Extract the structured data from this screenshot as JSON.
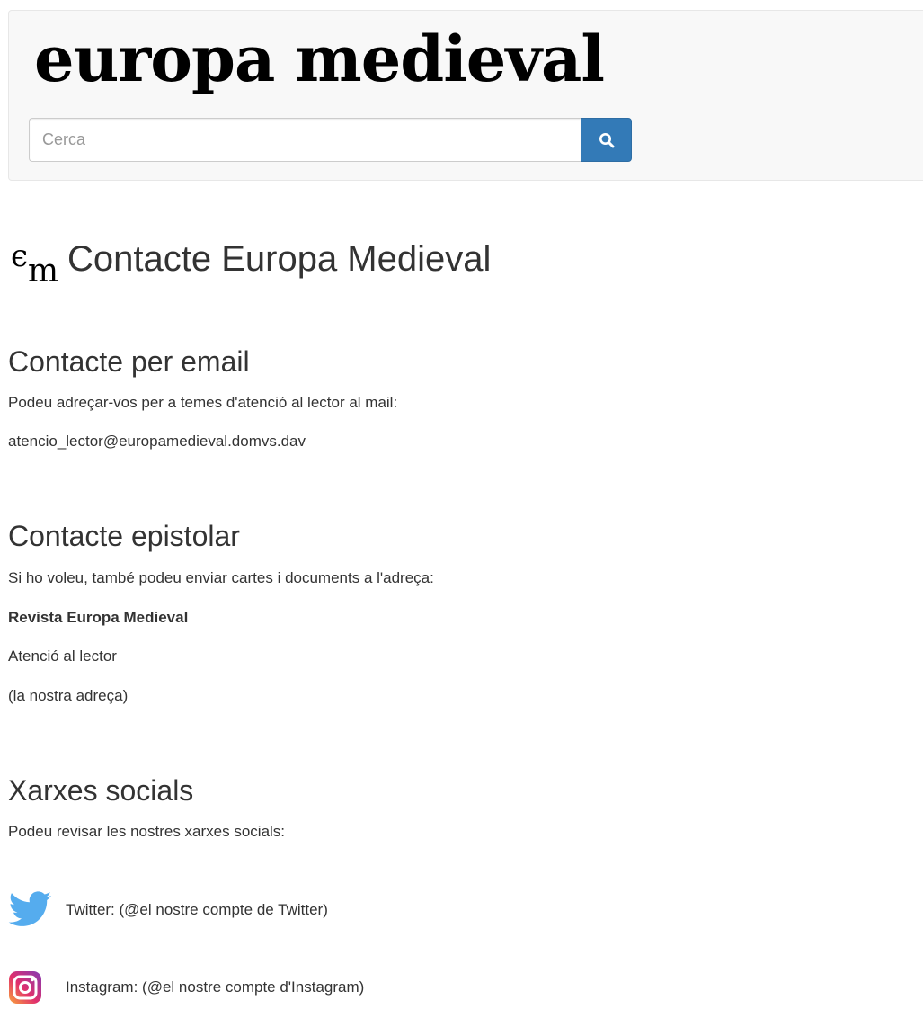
{
  "header": {
    "logo": "europa medieval",
    "search": {
      "placeholder": "Cerca",
      "value": "",
      "button_icon": "search-icon"
    }
  },
  "page": {
    "title_mark": {
      "letter1": "є",
      "letter2": "m"
    },
    "title": "Contacte Europa Medieval"
  },
  "sections": {
    "email": {
      "heading": "Contacte per email",
      "text": "Podeu adreçar-vos per a temes d'atenció al lector al mail:",
      "address": "atencio_lector@europamedieval.domvs.dav"
    },
    "letter": {
      "heading": "Contacte epistolar",
      "text": "Si ho voleu, també podeu enviar cartes i documents a l'adreça:",
      "lines": [
        "Revista Europa Medieval",
        "Atenció al lector",
        "(la nostra adreça)"
      ]
    },
    "social": {
      "heading": "Xarxes socials",
      "text": "Podeu revisar les nostres xarxes socials:",
      "items": [
        {
          "icon": "twitter-icon",
          "label": "Twitter: (@el nostre compte de Twitter)"
        },
        {
          "icon": "instagram-icon",
          "label": "Instagram: (@el nostre compte d'Instagram)"
        }
      ]
    }
  },
  "colors": {
    "primary_button": "#337ab7",
    "header_bg": "#f8f8f8",
    "twitter": "#55acee"
  }
}
